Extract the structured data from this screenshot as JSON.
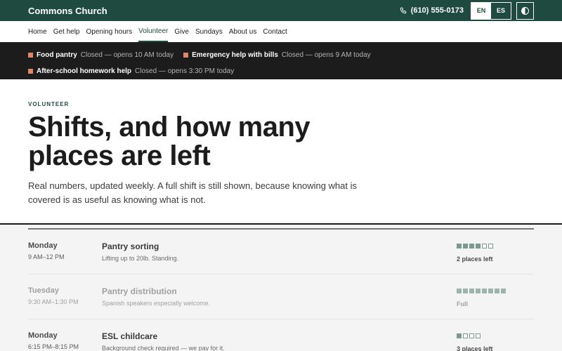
{
  "brand": "Commons Church",
  "phone": "(610) 555-0173",
  "languages": [
    "EN",
    "ES"
  ],
  "nav": [
    "Home",
    "Get help",
    "Opening hours",
    "Volunteer",
    "Give",
    "Sundays",
    "About us",
    "Contact"
  ],
  "nav_current": "Volunteer",
  "status": [
    {
      "name": "Food pantry",
      "note": "Closed — opens 10 AM today"
    },
    {
      "name": "Emergency help with bills",
      "note": "Closed — opens 9 AM today"
    },
    {
      "name": "After-school homework help",
      "note": "Closed — opens 3:30 PM today"
    }
  ],
  "hero": {
    "eyebrow": "VOLUNTEER",
    "title": "Shifts, and how many places are left",
    "lede": "Real numbers, updated weekly. A full shift is still shown, because knowing what is covered is as useful as knowing what is not."
  },
  "shifts": [
    {
      "day": "Monday",
      "time": "9 AM–12 PM",
      "role": "Pantry sorting",
      "desc": "Lifting up to 20lb. Standing.",
      "filled": 4,
      "total": 6,
      "left_label": "2 places left",
      "full": false
    },
    {
      "day": "Tuesday",
      "time": "9:30 AM–1:30 PM",
      "role": "Pantry distribution",
      "desc": "Spanish speakers especially welcome.",
      "filled": 8,
      "total": 8,
      "left_label": "Full",
      "full": true
    },
    {
      "day": "Monday",
      "time": "6:15 PM–8:15 PM",
      "role": "ESL childcare",
      "desc": "Background check required — we pay for it.",
      "filled": 1,
      "total": 4,
      "left_label": "3 places left",
      "full": false
    }
  ],
  "colors": {
    "brand": "#1e4a40",
    "status_marker": "#e0876a",
    "capacity": "#7a9a90"
  },
  "icons": {
    "phone": "phone-icon",
    "contrast": "contrast-toggle-icon"
  }
}
